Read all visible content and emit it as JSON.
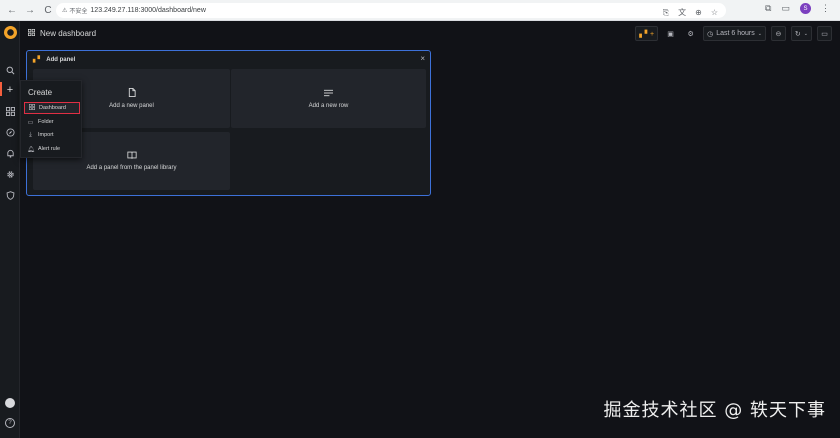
{
  "browser": {
    "back": "←",
    "forward": "→",
    "reload": "C",
    "security_label": "不安全",
    "url": "123.249.27.118:3000/dashboard/new",
    "profile_initial": "S"
  },
  "sidemenu": {
    "items": [
      "search-icon",
      "plus-icon",
      "apps-icon",
      "compass-icon",
      "bell-icon",
      "gear-icon",
      "shield-icon"
    ],
    "help": "?"
  },
  "topbar": {
    "title": "New dashboard",
    "time_range": "Last 6 hours"
  },
  "add_panel": {
    "title": "Add panel",
    "tiles": {
      "new_panel": "Add a new panel",
      "new_row": "Add a new row",
      "library": "Add a panel from the panel library"
    }
  },
  "create_menu": {
    "title": "Create",
    "items": [
      {
        "label": "Dashboard",
        "icon": "apps-icon",
        "highlighted": true
      },
      {
        "label": "Folder",
        "icon": "folder-icon",
        "highlighted": false
      },
      {
        "label": "Import",
        "icon": "import-icon",
        "highlighted": false
      },
      {
        "label": "Alert rule",
        "icon": "bell-icon",
        "highlighted": false
      }
    ]
  },
  "watermark": "掘金技术社区 @ 轶天下事",
  "colors": {
    "background": "#111217",
    "panel": "#181b1f",
    "tile": "#22252b",
    "accent_blue": "#3d71d9",
    "highlight_red": "#e02f44",
    "logo_orange": "#f4a429"
  }
}
